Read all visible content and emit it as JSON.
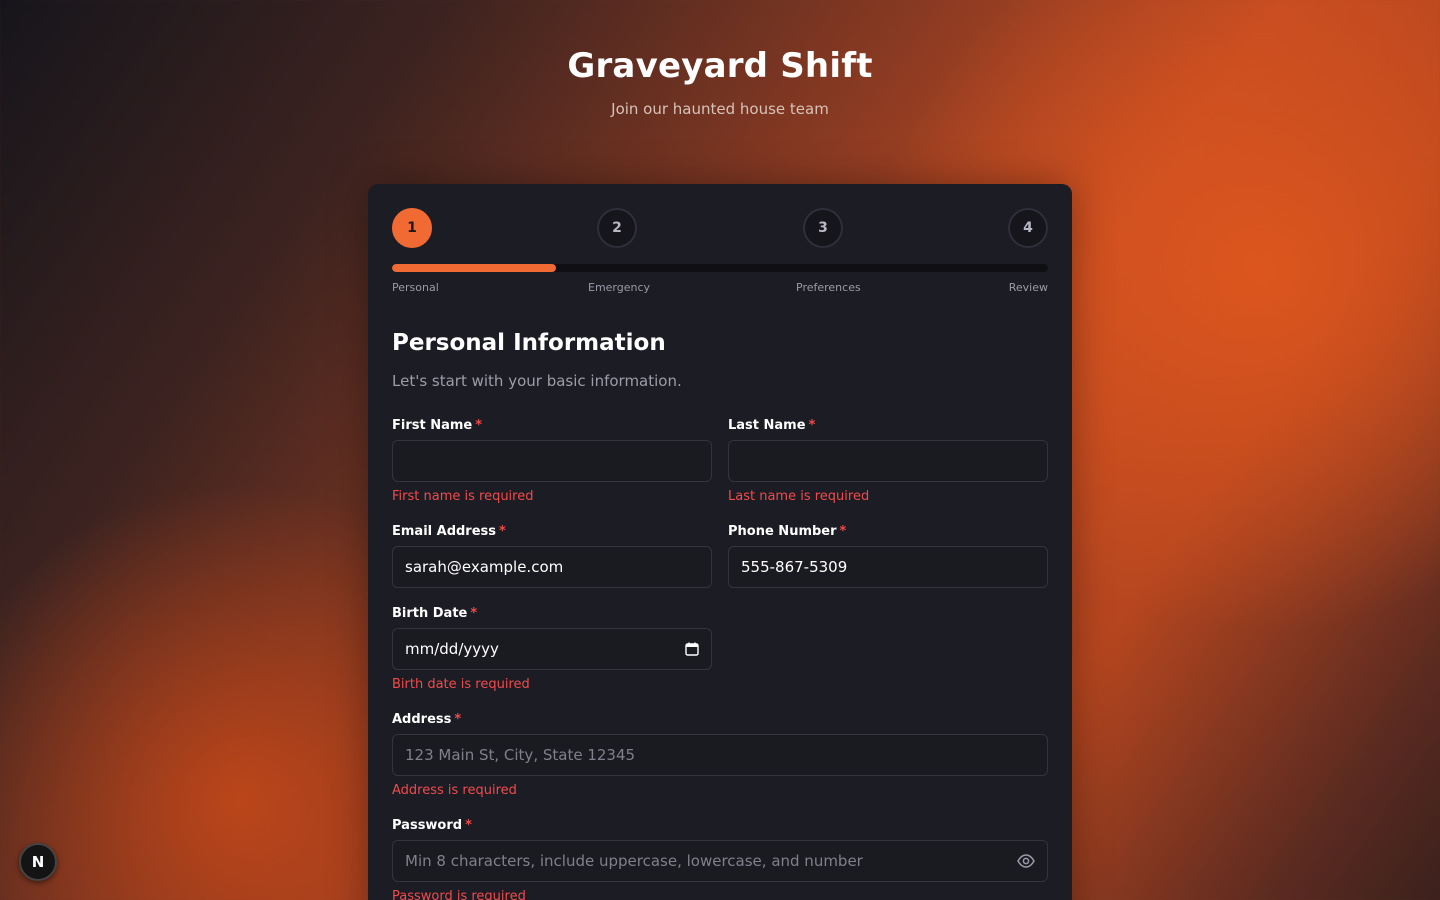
{
  "header": {
    "title": "Graveyard Shift",
    "subtitle": "Join our haunted house team"
  },
  "stepper": {
    "current_step": 1,
    "progress_fraction": 0.25,
    "steps": [
      {
        "number": "1",
        "label": "Personal"
      },
      {
        "number": "2",
        "label": "Emergency"
      },
      {
        "number": "3",
        "label": "Preferences"
      },
      {
        "number": "4",
        "label": "Review"
      }
    ]
  },
  "section": {
    "title": "Personal Information",
    "subtitle": "Let's start with your basic information."
  },
  "required_marker": "*",
  "fields": {
    "first_name": {
      "label": "First Name",
      "value": "",
      "placeholder": "",
      "error": "First name is required"
    },
    "last_name": {
      "label": "Last Name",
      "value": "",
      "placeholder": "",
      "error": "Last name is required"
    },
    "email": {
      "label": "Email Address",
      "value": "sarah@example.com"
    },
    "phone": {
      "label": "Phone Number",
      "value": "555-867-5309"
    },
    "birth_date": {
      "label": "Birth Date",
      "value": "mm/dd/yyyy",
      "error": "Birth date is required"
    },
    "address": {
      "label": "Address",
      "placeholder": "123 Main St, City, State 12345",
      "error": "Address is required"
    },
    "password": {
      "label": "Password",
      "placeholder": "Min 8 characters, include uppercase, lowercase, and number",
      "error": "Password is required"
    }
  },
  "dev_badge": {
    "letter": "N"
  },
  "colors": {
    "accent": "#f26a33",
    "error": "#f04b4b",
    "card_bg": "#1c1c24"
  }
}
